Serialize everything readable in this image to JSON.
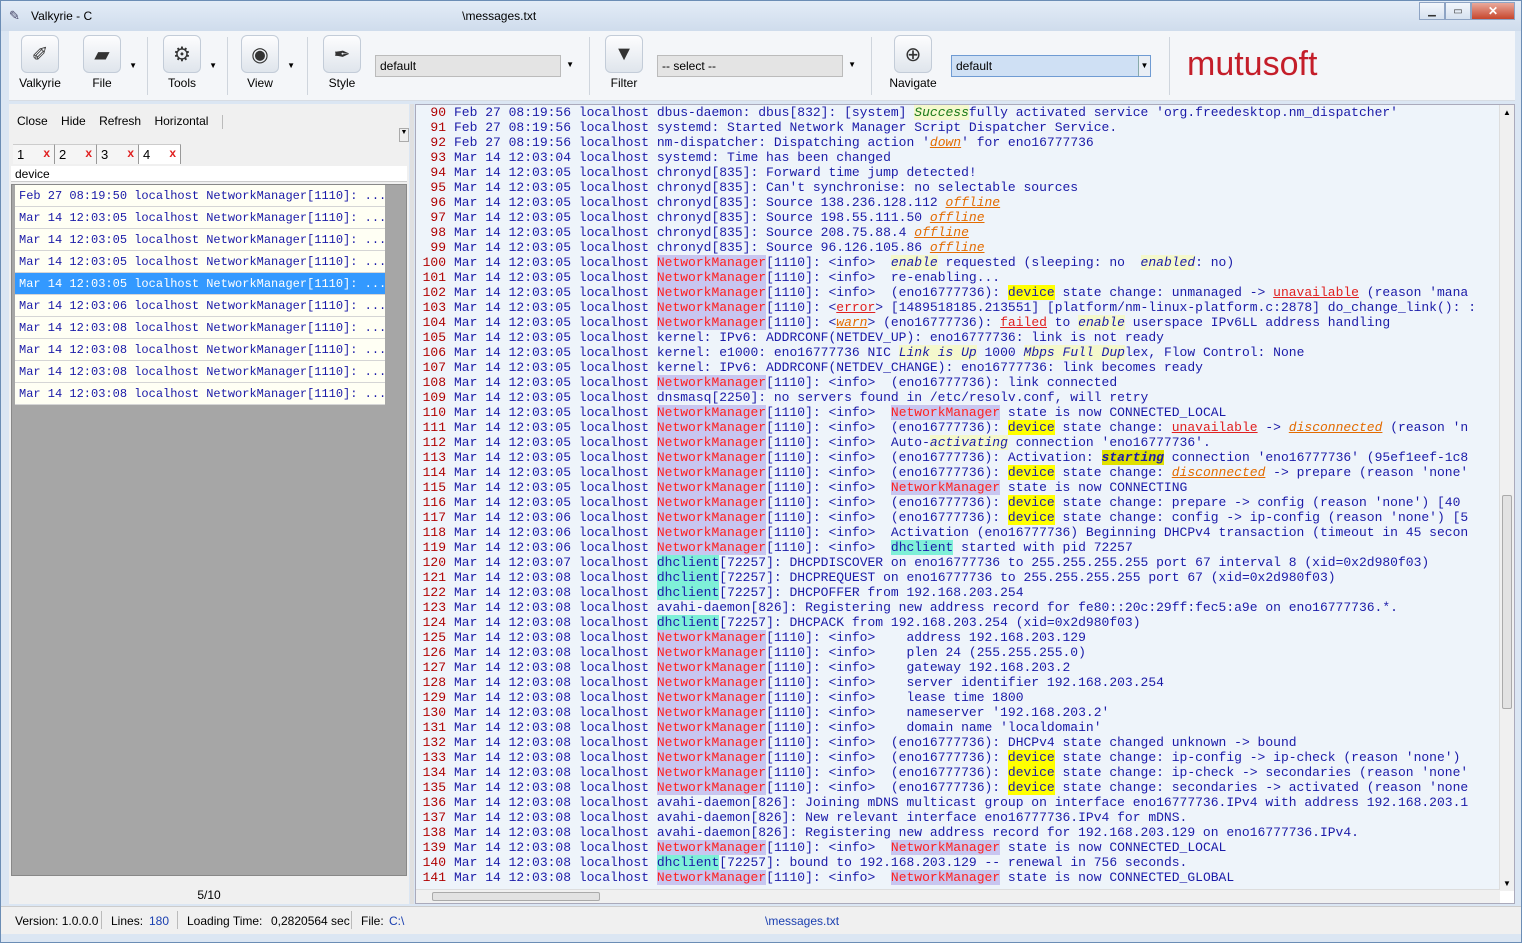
{
  "window": {
    "title": "Valkyrie - C:\\...\\messages.txt",
    "title_short": "Valkyrie - C",
    "title_file": "\\messages.txt"
  },
  "toolbar": {
    "valkyrie": "Valkyrie",
    "file": "File",
    "tools": "Tools",
    "view": "View",
    "style": "Style",
    "style_combo": "default",
    "filter": "Filter",
    "filter_combo": "-- select --",
    "navigate": "Navigate",
    "navigate_combo": "default",
    "logo": "mutusoft"
  },
  "left": {
    "actions": [
      "Close",
      "Hide",
      "Refresh",
      "Horizontal"
    ],
    "tabs": [
      "1",
      "2",
      "3",
      "4"
    ],
    "tab_close": "x",
    "header": "device",
    "results": [
      "Feb 27 08:19:50 localhost NetworkManager[1110]: ...",
      "Mar 14 12:03:05 localhost NetworkManager[1110]: ...",
      "Mar 14 12:03:05 localhost NetworkManager[1110]: ...",
      "Mar 14 12:03:05 localhost NetworkManager[1110]: ...",
      "Mar 14 12:03:05 localhost NetworkManager[1110]: ...",
      "Mar 14 12:03:06 localhost NetworkManager[1110]: ...",
      "Mar 14 12:03:08 localhost NetworkManager[1110]: ...",
      "Mar 14 12:03:08 localhost NetworkManager[1110]: ...",
      "Mar 14 12:03:08 localhost NetworkManager[1110]: ...",
      "Mar 14 12:03:08 localhost NetworkManager[1110]: ..."
    ],
    "selected_index": 4,
    "pager": "5/10"
  },
  "status": {
    "version_label": "Version: 1.0.0.0",
    "lines_label": "Lines:",
    "lines": "180",
    "loading_label": "Loading Time:",
    "loading": "0,2820564 sec",
    "file_label": "File:",
    "file_prefix": "C:\\",
    "file_name": "\\messages.txt"
  },
  "log": [
    {
      "n": "90",
      "d": "Feb 27 08:19:56",
      "t": "localhost dbus-daemon: dbus[832]: [system] ",
      "a": [
        [
          "g",
          "Success"
        ],
        [
          "",
          "fully activated service 'org.freedesktop.nm_dispatcher'"
        ]
      ]
    },
    {
      "n": "91",
      "d": "Feb 27 08:19:56",
      "t": "localhost systemd: Started Network Manager Script Dispatcher Service.",
      "a": []
    },
    {
      "n": "92",
      "d": "Feb 27 08:19:56",
      "t": "localhost nm-dispatcher: Dispatching action '",
      "a": [
        [
          "o",
          "down"
        ],
        [
          "",
          "' for eno16777736"
        ]
      ]
    },
    {
      "n": "93",
      "d": "Mar 14 12:03:04",
      "t": "localhost systemd: Time has been changed",
      "a": []
    },
    {
      "n": "94",
      "d": "Mar 14 12:03:05",
      "t": "localhost chronyd[835]: Forward time jump detected!",
      "a": []
    },
    {
      "n": "95",
      "d": "Mar 14 12:03:05",
      "t": "localhost chronyd[835]: Can't synchronise: no selectable sources",
      "a": []
    },
    {
      "n": "96",
      "d": "Mar 14 12:03:05",
      "t": "localhost chronyd[835]: Source 138.236.128.112 ",
      "a": [
        [
          "o",
          "offline"
        ]
      ]
    },
    {
      "n": "97",
      "d": "Mar 14 12:03:05",
      "t": "localhost chronyd[835]: Source 198.55.111.50 ",
      "a": [
        [
          "o",
          "offline"
        ]
      ]
    },
    {
      "n": "98",
      "d": "Mar 14 12:03:05",
      "t": "localhost chronyd[835]: Source 208.75.88.4 ",
      "a": [
        [
          "o",
          "offline"
        ]
      ]
    },
    {
      "n": "99",
      "d": "Mar 14 12:03:05",
      "t": "localhost chronyd[835]: Source 96.126.105.86 ",
      "a": [
        [
          "o",
          "offline"
        ]
      ]
    },
    {
      "n": "100",
      "d": "Mar 14 12:03:05",
      "t": "localhost ",
      "a": [
        [
          "nm",
          "NetworkManager"
        ],
        [
          "",
          "[1110]: <info>  "
        ],
        [
          "b",
          "enable"
        ],
        [
          "",
          " requested (sleeping: no  "
        ],
        [
          "b",
          "enabled"
        ],
        [
          "",
          ": no)"
        ]
      ]
    },
    {
      "n": "101",
      "d": "Mar 14 12:03:05",
      "t": "localhost ",
      "a": [
        [
          "nm",
          "NetworkManager"
        ],
        [
          "",
          "[1110]: <info>  re-enabling..."
        ]
      ]
    },
    {
      "n": "102",
      "d": "Mar 14 12:03:05",
      "t": "localhost ",
      "a": [
        [
          "nm",
          "NetworkManager"
        ],
        [
          "",
          "[1110]: <info>  (eno16777736): "
        ],
        [
          "dev",
          "device"
        ],
        [
          "",
          " state change: unmanaged -> "
        ],
        [
          "r",
          "unavailable"
        ],
        [
          "",
          " (reason 'mana"
        ]
      ]
    },
    {
      "n": "103",
      "d": "Mar 14 12:03:05",
      "t": "localhost ",
      "a": [
        [
          "nm",
          "NetworkManager"
        ],
        [
          "",
          "[1110]: <"
        ],
        [
          "r",
          "error"
        ],
        [
          "",
          "> [1489518185.213551] [platform/nm-linux-platform.c:2878] do_change_link(): :"
        ]
      ]
    },
    {
      "n": "104",
      "d": "Mar 14 12:03:05",
      "t": "localhost ",
      "a": [
        [
          "nm",
          "NetworkManager"
        ],
        [
          "",
          "[1110]: <"
        ],
        [
          "o",
          "warn"
        ],
        [
          "",
          "> (eno16777736): "
        ],
        [
          "r",
          "failed"
        ],
        [
          "",
          " to "
        ],
        [
          "b",
          "enable"
        ],
        [
          "",
          " userspace IPv6LL address handling"
        ]
      ]
    },
    {
      "n": "105",
      "d": "Mar 14 12:03:05",
      "t": "localhost kernel: IPv6: ADDRCONF(NETDEV_UP): eno16777736: link is not ready",
      "a": []
    },
    {
      "n": "106",
      "d": "Mar 14 12:03:05",
      "t": "localhost kernel: e1000: eno16777736 NIC ",
      "a": [
        [
          "b",
          "Link is Up"
        ],
        [
          "",
          " 1000 "
        ],
        [
          "b",
          "Mbps Full Dup"
        ],
        [
          "",
          "lex, Flow Control: None"
        ]
      ]
    },
    {
      "n": "107",
      "d": "Mar 14 12:03:05",
      "t": "localhost kernel: IPv6: ADDRCONF(NETDEV_CHANGE): eno16777736: link becomes ready",
      "a": []
    },
    {
      "n": "108",
      "d": "Mar 14 12:03:05",
      "t": "localhost ",
      "a": [
        [
          "nm",
          "NetworkManager"
        ],
        [
          "",
          "[1110]: <info>  (eno16777736): link connected"
        ]
      ]
    },
    {
      "n": "109",
      "d": "Mar 14 12:03:05",
      "t": "localhost dnsmasq[2250]: no servers found in /etc/resolv.conf, will retry",
      "a": []
    },
    {
      "n": "110",
      "d": "Mar 14 12:03:05",
      "t": "localhost ",
      "a": [
        [
          "nm",
          "NetworkManager"
        ],
        [
          "",
          "[1110]: <info>  "
        ],
        [
          "nm",
          "NetworkManager"
        ],
        [
          "",
          " state is now CONNECTED_LOCAL"
        ]
      ]
    },
    {
      "n": "111",
      "d": "Mar 14 12:03:05",
      "t": "localhost ",
      "a": [
        [
          "nm",
          "NetworkManager"
        ],
        [
          "",
          "[1110]: <info>  (eno16777736): "
        ],
        [
          "dev",
          "device"
        ],
        [
          "",
          " state change: "
        ],
        [
          "r",
          "unavailable"
        ],
        [
          "",
          " -> "
        ],
        [
          "o",
          "disconnected"
        ],
        [
          "",
          " (reason 'n"
        ]
      ]
    },
    {
      "n": "112",
      "d": "Mar 14 12:03:05",
      "t": "localhost ",
      "a": [
        [
          "nm",
          "NetworkManager"
        ],
        [
          "",
          "[1110]: <info>  Auto-"
        ],
        [
          "b",
          "activating"
        ],
        [
          "",
          " connection 'eno16777736'."
        ]
      ]
    },
    {
      "n": "113",
      "d": "Mar 14 12:03:05",
      "t": "localhost ",
      "a": [
        [
          "nm",
          "NetworkManager"
        ],
        [
          "",
          "[1110]: <info>  (eno16777736): Activation: "
        ],
        [
          "st",
          "starting"
        ],
        [
          "",
          " connection 'eno16777736' (95ef1eef-1c8"
        ]
      ]
    },
    {
      "n": "114",
      "d": "Mar 14 12:03:05",
      "t": "localhost ",
      "a": [
        [
          "nm",
          "NetworkManager"
        ],
        [
          "",
          "[1110]: <info>  (eno16777736): "
        ],
        [
          "dev",
          "device"
        ],
        [
          "",
          " state change: "
        ],
        [
          "o",
          "disconnected"
        ],
        [
          "",
          " -> prepare (reason 'none'"
        ]
      ]
    },
    {
      "n": "115",
      "d": "Mar 14 12:03:05",
      "t": "localhost ",
      "a": [
        [
          "nm",
          "NetworkManager"
        ],
        [
          "",
          "[1110]: <info>  "
        ],
        [
          "nm",
          "NetworkManager"
        ],
        [
          "",
          " state is now CONNECTING"
        ]
      ]
    },
    {
      "n": "116",
      "d": "Mar 14 12:03:05",
      "t": "localhost ",
      "a": [
        [
          "nm",
          "NetworkManager"
        ],
        [
          "",
          "[1110]: <info>  (eno16777736): "
        ],
        [
          "dev",
          "device"
        ],
        [
          "",
          " state change: prepare -> config (reason 'none') [40"
        ]
      ]
    },
    {
      "n": "117",
      "d": "Mar 14 12:03:06",
      "t": "localhost ",
      "a": [
        [
          "nm",
          "NetworkManager"
        ],
        [
          "",
          "[1110]: <info>  (eno16777736): "
        ],
        [
          "dev",
          "device"
        ],
        [
          "",
          " state change: config -> ip-config (reason 'none') [5"
        ]
      ]
    },
    {
      "n": "118",
      "d": "Mar 14 12:03:06",
      "t": "localhost ",
      "a": [
        [
          "nm",
          "NetworkManager"
        ],
        [
          "",
          "[1110]: <info>  Activation (eno16777736) Beginning DHCPv4 transaction (timeout in 45 secon"
        ]
      ]
    },
    {
      "n": "119",
      "d": "Mar 14 12:03:06",
      "t": "localhost ",
      "a": [
        [
          "nm",
          "NetworkManager"
        ],
        [
          "",
          "[1110]: <info>  "
        ],
        [
          "dh",
          "dhclient"
        ],
        [
          "",
          " started with pid 72257"
        ]
      ]
    },
    {
      "n": "120",
      "d": "Mar 14 12:03:07",
      "t": "localhost ",
      "a": [
        [
          "dh",
          "dhclient"
        ],
        [
          "",
          "[72257]: DHCPDISCOVER on eno16777736 to 255.255.255.255 port 67 interval 8 (xid=0x2d980f03)"
        ]
      ]
    },
    {
      "n": "121",
      "d": "Mar 14 12:03:08",
      "t": "localhost ",
      "a": [
        [
          "dh",
          "dhclient"
        ],
        [
          "",
          "[72257]: DHCPREQUEST on eno16777736 to 255.255.255.255 port 67 (xid=0x2d980f03)"
        ]
      ]
    },
    {
      "n": "122",
      "d": "Mar 14 12:03:08",
      "t": "localhost ",
      "a": [
        [
          "dh",
          "dhclient"
        ],
        [
          "",
          "[72257]: DHCPOFFER from 192.168.203.254"
        ]
      ]
    },
    {
      "n": "123",
      "d": "Mar 14 12:03:08",
      "t": "localhost avahi-daemon[826]: Registering new address record for fe80::20c:29ff:fec5:a9e on eno16777736.*.",
      "a": []
    },
    {
      "n": "124",
      "d": "Mar 14 12:03:08",
      "t": "localhost ",
      "a": [
        [
          "dh",
          "dhclient"
        ],
        [
          "",
          "[72257]: DHCPACK from 192.168.203.254 (xid=0x2d980f03)"
        ]
      ]
    },
    {
      "n": "125",
      "d": "Mar 14 12:03:08",
      "t": "localhost ",
      "a": [
        [
          "nm",
          "NetworkManager"
        ],
        [
          "",
          "[1110]: <info>    address 192.168.203.129"
        ]
      ]
    },
    {
      "n": "126",
      "d": "Mar 14 12:03:08",
      "t": "localhost ",
      "a": [
        [
          "nm",
          "NetworkManager"
        ],
        [
          "",
          "[1110]: <info>    plen 24 (255.255.255.0)"
        ]
      ]
    },
    {
      "n": "127",
      "d": "Mar 14 12:03:08",
      "t": "localhost ",
      "a": [
        [
          "nm",
          "NetworkManager"
        ],
        [
          "",
          "[1110]: <info>    gateway 192.168.203.2"
        ]
      ]
    },
    {
      "n": "128",
      "d": "Mar 14 12:03:08",
      "t": "localhost ",
      "a": [
        [
          "nm",
          "NetworkManager"
        ],
        [
          "",
          "[1110]: <info>    server identifier 192.168.203.254"
        ]
      ]
    },
    {
      "n": "129",
      "d": "Mar 14 12:03:08",
      "t": "localhost ",
      "a": [
        [
          "nm",
          "NetworkManager"
        ],
        [
          "",
          "[1110]: <info>    lease time 1800"
        ]
      ]
    },
    {
      "n": "130",
      "d": "Mar 14 12:03:08",
      "t": "localhost ",
      "a": [
        [
          "nm",
          "NetworkManager"
        ],
        [
          "",
          "[1110]: <info>    nameserver '192.168.203.2'"
        ]
      ]
    },
    {
      "n": "131",
      "d": "Mar 14 12:03:08",
      "t": "localhost ",
      "a": [
        [
          "nm",
          "NetworkManager"
        ],
        [
          "",
          "[1110]: <info>    domain name 'localdomain'"
        ]
      ]
    },
    {
      "n": "132",
      "d": "Mar 14 12:03:08",
      "t": "localhost ",
      "a": [
        [
          "nm",
          "NetworkManager"
        ],
        [
          "",
          "[1110]: <info>  (eno16777736): DHCPv4 state changed unknown -> bound"
        ]
      ]
    },
    {
      "n": "133",
      "d": "Mar 14 12:03:08",
      "t": "localhost ",
      "a": [
        [
          "nm",
          "NetworkManager"
        ],
        [
          "",
          "[1110]: <info>  (eno16777736): "
        ],
        [
          "dev",
          "device"
        ],
        [
          "",
          " state change: ip-config -> ip-check (reason 'none')"
        ]
      ]
    },
    {
      "n": "134",
      "d": "Mar 14 12:03:08",
      "t": "localhost ",
      "a": [
        [
          "nm",
          "NetworkManager"
        ],
        [
          "",
          "[1110]: <info>  (eno16777736): "
        ],
        [
          "dev",
          "device"
        ],
        [
          "",
          " state change: ip-check -> secondaries (reason 'none'"
        ]
      ]
    },
    {
      "n": "135",
      "d": "Mar 14 12:03:08",
      "t": "localhost ",
      "a": [
        [
          "nm",
          "NetworkManager"
        ],
        [
          "",
          "[1110]: <info>  (eno16777736): "
        ],
        [
          "dev",
          "device"
        ],
        [
          "",
          " state change: secondaries -> activated (reason 'none"
        ]
      ]
    },
    {
      "n": "136",
      "d": "Mar 14 12:03:08",
      "t": "localhost avahi-daemon[826]: Joining mDNS multicast group on interface eno16777736.IPv4 with address 192.168.203.1",
      "a": []
    },
    {
      "n": "137",
      "d": "Mar 14 12:03:08",
      "t": "localhost avahi-daemon[826]: New relevant interface eno16777736.IPv4 for mDNS.",
      "a": []
    },
    {
      "n": "138",
      "d": "Mar 14 12:03:08",
      "t": "localhost avahi-daemon[826]: Registering new address record for 192.168.203.129 on eno16777736.IPv4.",
      "a": []
    },
    {
      "n": "139",
      "d": "Mar 14 12:03:08",
      "t": "localhost ",
      "a": [
        [
          "nm",
          "NetworkManager"
        ],
        [
          "",
          "[1110]: <info>  "
        ],
        [
          "nm",
          "NetworkManager"
        ],
        [
          "",
          " state is now CONNECTED_LOCAL"
        ]
      ]
    },
    {
      "n": "140",
      "d": "Mar 14 12:03:08",
      "t": "localhost ",
      "a": [
        [
          "dh",
          "dhclient"
        ],
        [
          "",
          "[72257]: bound to 192.168.203.129 -- renewal in 756 seconds."
        ]
      ]
    },
    {
      "n": "141",
      "d": "Mar 14 12:03:08",
      "t": "localhost ",
      "a": [
        [
          "nm",
          "NetworkManager"
        ],
        [
          "",
          "[1110]: <info>  "
        ],
        [
          "nm",
          "NetworkManager"
        ],
        [
          "",
          " state is now CONNECTED_GLOBAL"
        ]
      ]
    }
  ]
}
